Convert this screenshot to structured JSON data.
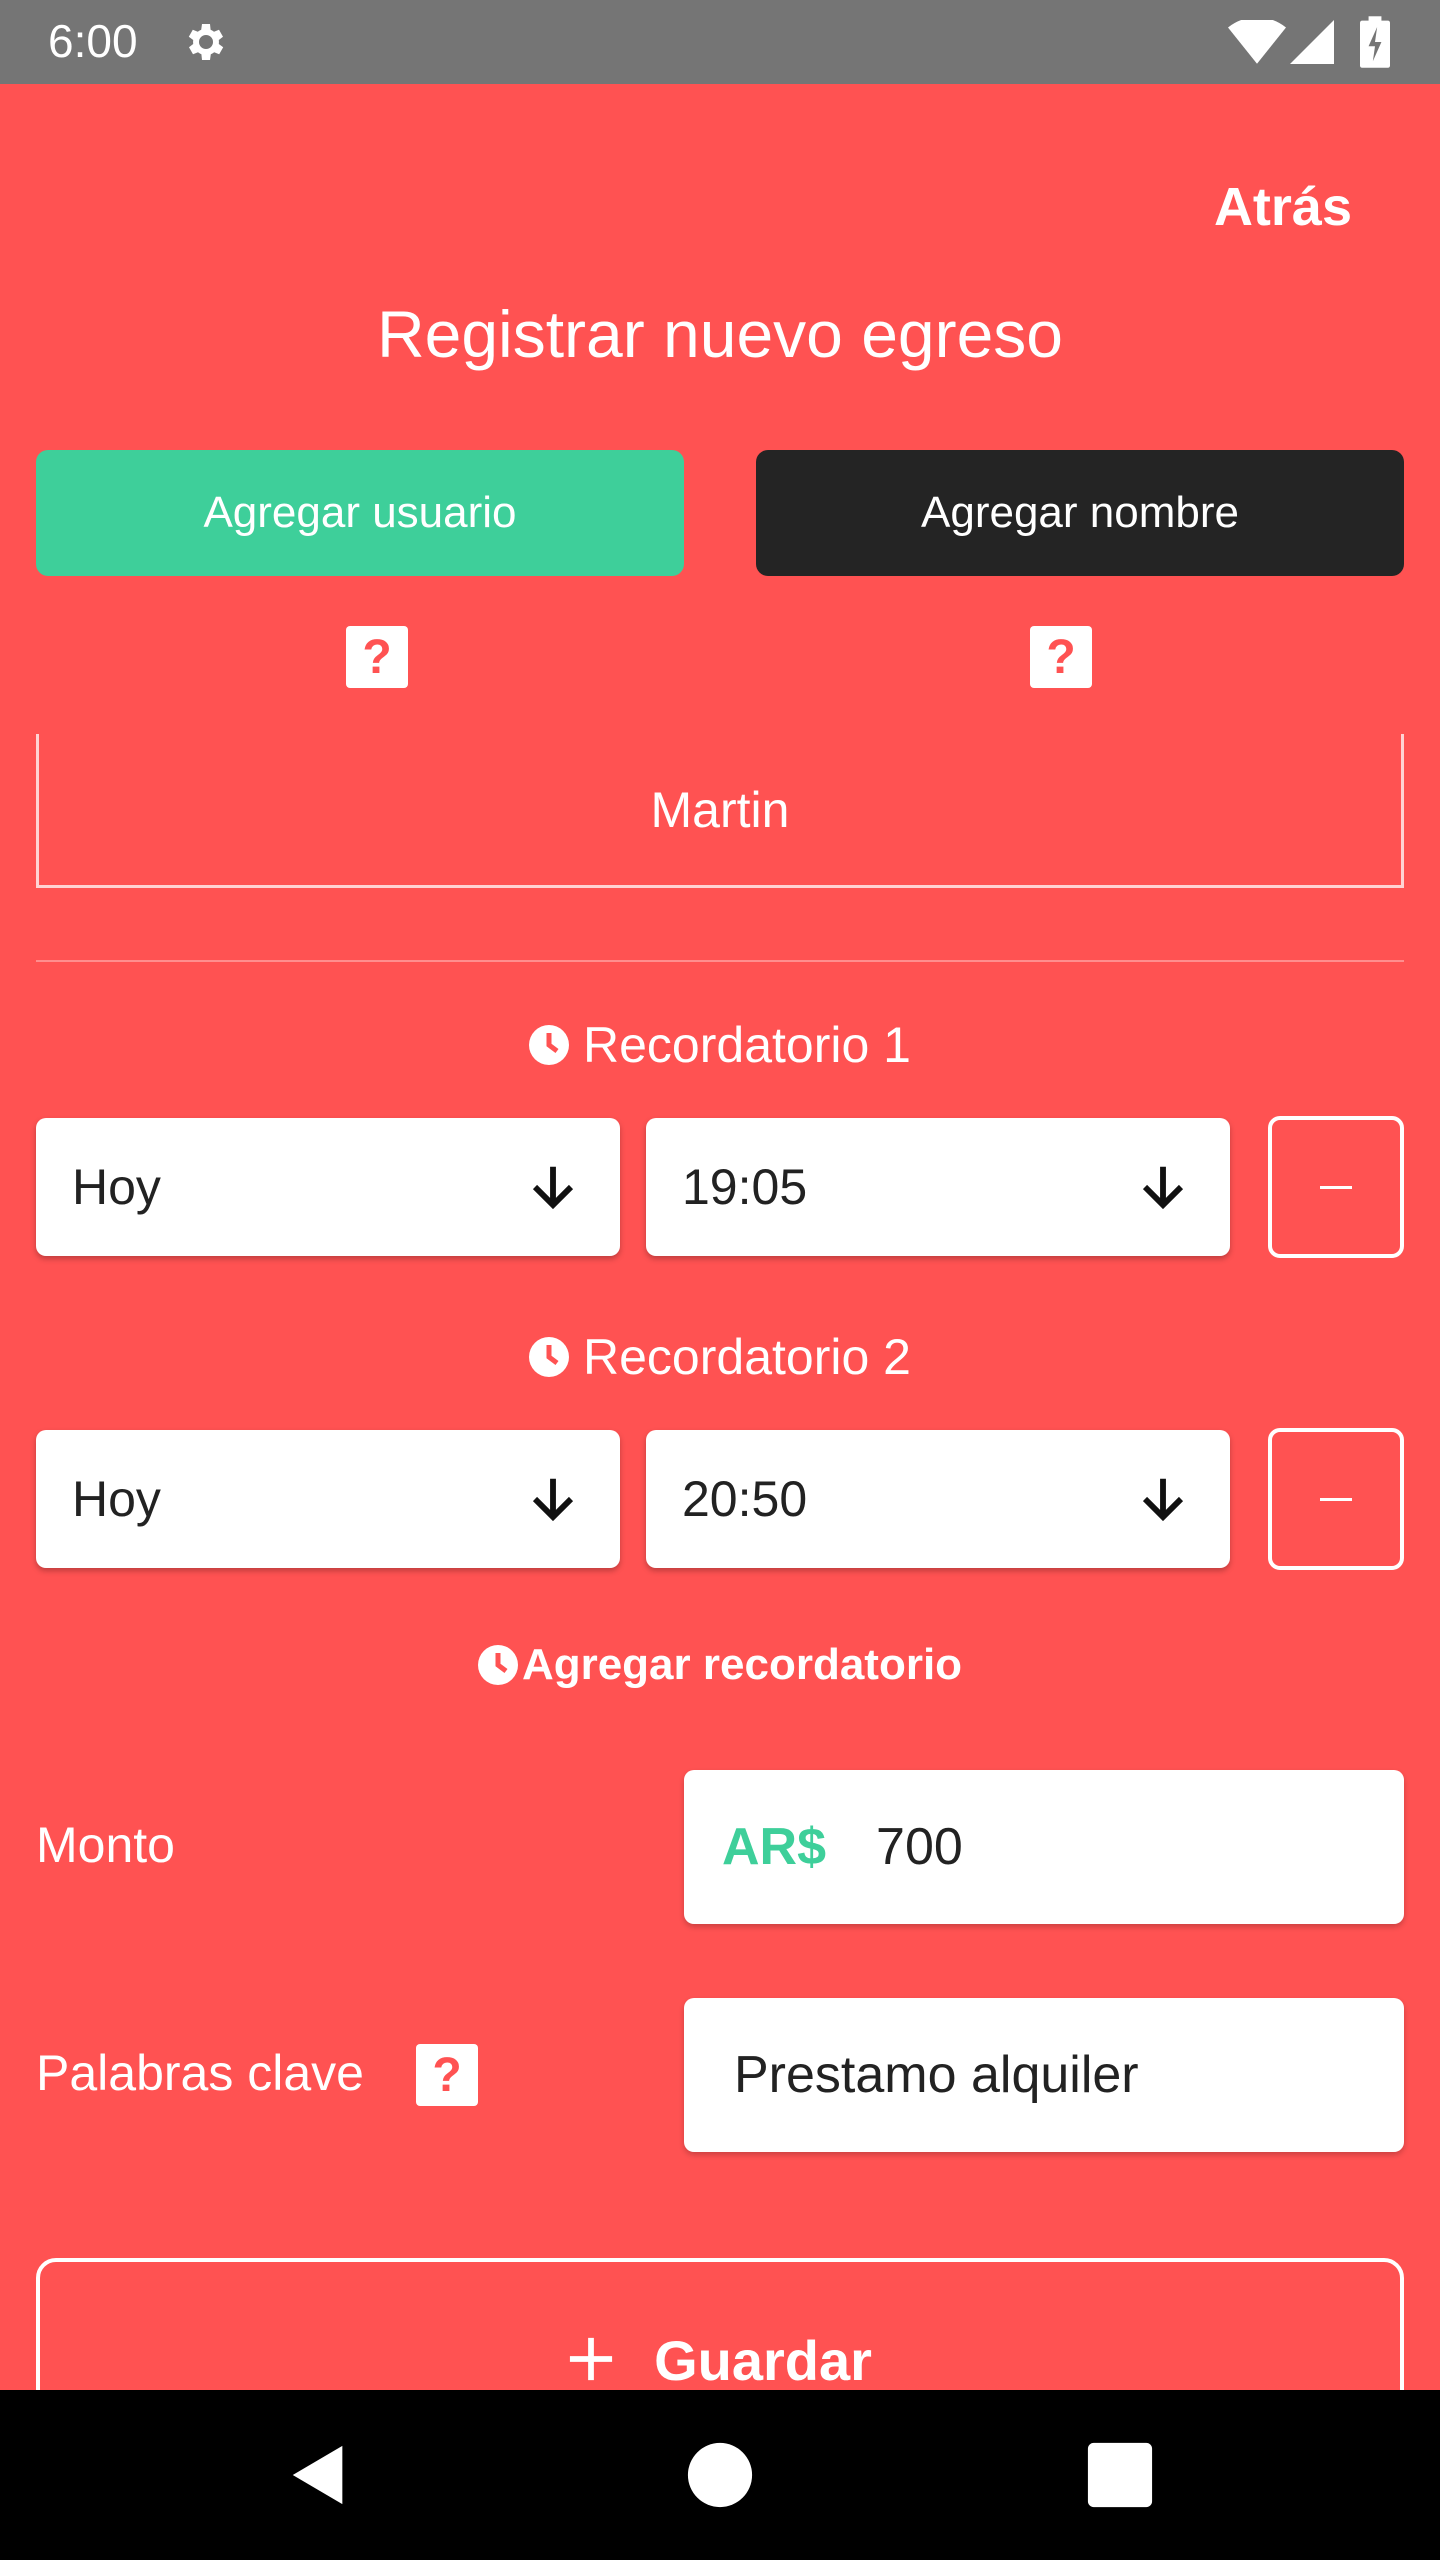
{
  "status_bar": {
    "time": "6:00",
    "icons": [
      "gear-icon",
      "wifi-icon",
      "cell-signal-icon",
      "battery-charging-icon"
    ]
  },
  "header": {
    "back_label": "Atrás",
    "title": "Registrar nuevo egreso"
  },
  "actions": {
    "add_user_label": "Agregar usuario",
    "add_name_label": "Agregar nombre",
    "help_symbol": "?"
  },
  "name_field": {
    "value": "Martin"
  },
  "reminders": [
    {
      "label": "Recordatorio 1",
      "day": "Hoy",
      "time": "19:05"
    },
    {
      "label": "Recordatorio 2",
      "day": "Hoy",
      "time": "20:50"
    }
  ],
  "add_reminder_label": "Agregar recordatorio",
  "amount": {
    "label": "Monto",
    "currency": "AR$",
    "value": "700"
  },
  "keywords": {
    "label": "Palabras clave",
    "value": "Prestamo alquiler"
  },
  "save_label": "Guardar",
  "colors": {
    "background": "#ff5252",
    "accent_green": "#3ecf9a",
    "dark_button": "#242424",
    "status_bar": "#757575",
    "nav_bar": "#000000"
  }
}
